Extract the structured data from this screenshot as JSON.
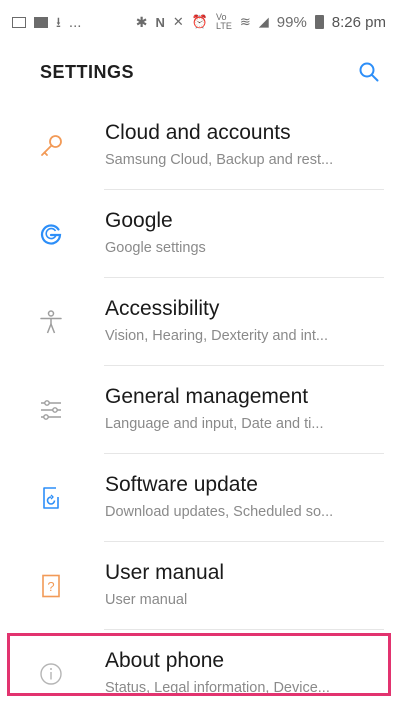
{
  "status_bar": {
    "ellipsis": "...",
    "battery": "99%",
    "time": "8:26 pm",
    "left_icons": [
      "image-icon",
      "news-icon",
      "download-icon"
    ],
    "right_icons": [
      "bluetooth-icon",
      "nfc-icon",
      "mute-icon",
      "alarm-icon",
      "volte-icon",
      "wifi-icon",
      "signal-icon",
      "battery-icon"
    ]
  },
  "header": {
    "title": "SETTINGS",
    "search_icon": "search-icon"
  },
  "colors": {
    "accent_blue": "#2c8ef8",
    "orange": "#f29a57",
    "grey_icon": "#9e9e9e",
    "highlight": "#e2336f"
  },
  "items": [
    {
      "title": "Cloud and accounts",
      "subtitle": "Samsung Cloud, Backup and rest...",
      "icon": "key-icon"
    },
    {
      "title": "Google",
      "subtitle": "Google settings",
      "icon": "google-icon"
    },
    {
      "title": "Accessibility",
      "subtitle": "Vision, Hearing, Dexterity and int...",
      "icon": "accessibility-icon"
    },
    {
      "title": "General management",
      "subtitle": "Language and input, Date and ti...",
      "icon": "sliders-icon"
    },
    {
      "title": "Software update",
      "subtitle": "Download updates, Scheduled so...",
      "icon": "software-update-icon"
    },
    {
      "title": "User manual",
      "subtitle": "User manual",
      "icon": "user-manual-icon"
    },
    {
      "title": "About phone",
      "subtitle": "Status, Legal information, Device...",
      "icon": "info-icon"
    }
  ]
}
